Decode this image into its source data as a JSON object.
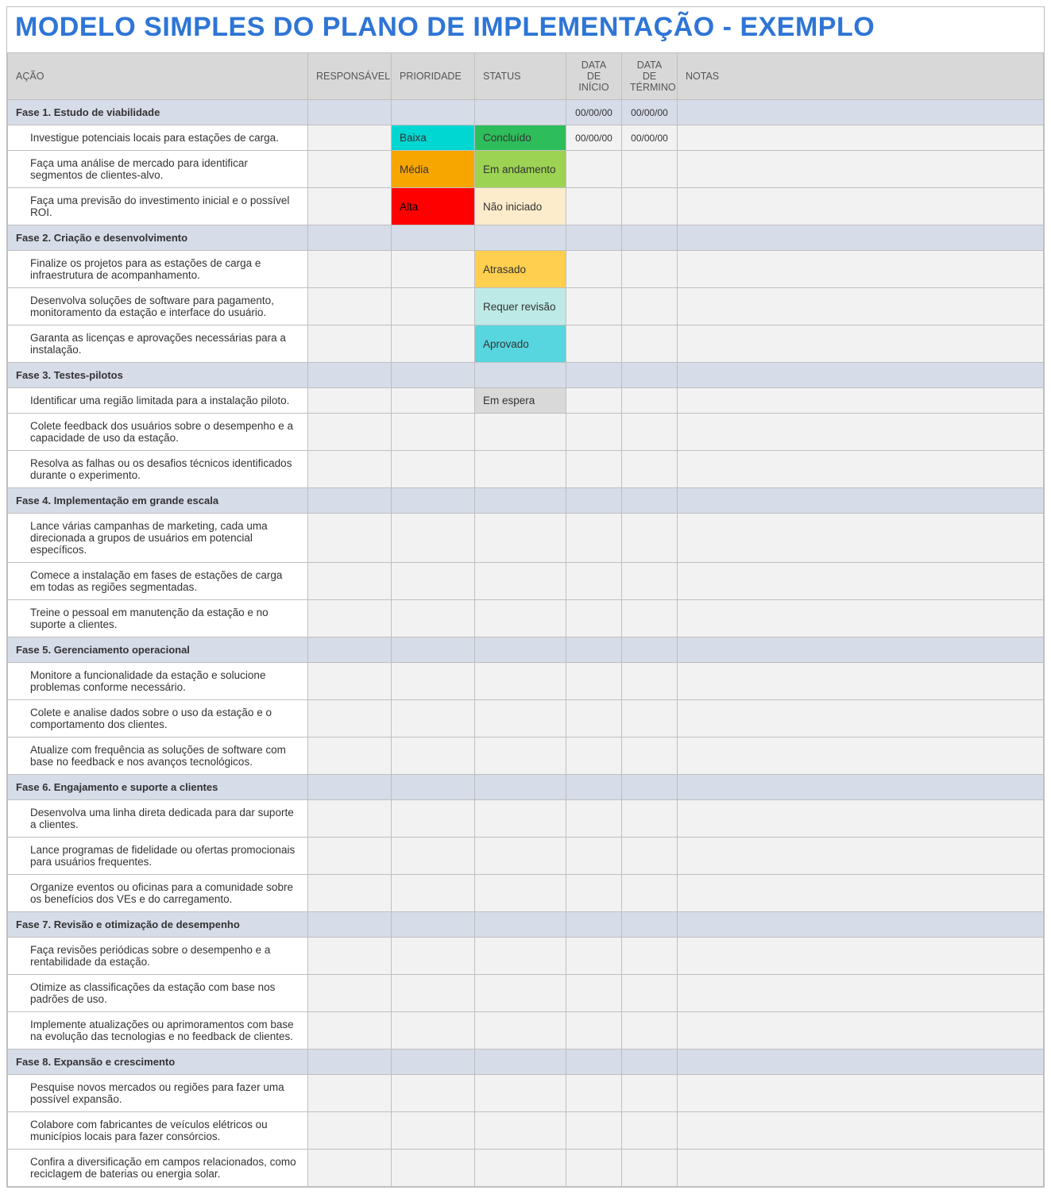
{
  "title": "MODELO SIMPLES DO PLANO DE IMPLEMENTAÇÃO - EXEMPLO",
  "headers": {
    "action": "AÇÃO",
    "responsible": "RESPONSÁVEL",
    "priority": "PRIORIDADE",
    "status": "STATUS",
    "start": "DATA DE INÍCIO",
    "end": "DATA DE TÉRMINO",
    "notes": "NOTAS"
  },
  "date_placeholder": "00/00/00",
  "priority_labels": {
    "baixa": "Baixa",
    "media": "Média",
    "alta": "Alta"
  },
  "status_labels": {
    "concluido": "Concluído",
    "andamento": "Em andamento",
    "nao": "Não iniciado",
    "atrasado": "Atrasado",
    "revisao": "Requer revisão",
    "aprovado": "Aprovado",
    "espera": "Em espera"
  },
  "phases": [
    {
      "label": "Fase 1.  Estudo de viabilidade",
      "start": "00/00/00",
      "end": "00/00/00",
      "tasks": [
        {
          "action": "Investigue potenciais locais para estações de carga.",
          "priority": "baixa",
          "status": "concluido",
          "start": "00/00/00",
          "end": "00/00/00"
        },
        {
          "action": "Faça uma análise de mercado para identificar segmentos de clientes-alvo.",
          "priority": "media",
          "status": "andamento"
        },
        {
          "action": "Faça uma previsão do investimento inicial e o possível ROI.",
          "priority": "alta",
          "status": "nao"
        }
      ]
    },
    {
      "label": "Fase 2.  Criação e desenvolvimento",
      "tasks": [
        {
          "action": "Finalize os projetos para as estações de carga e infraestrutura de acompanhamento.",
          "status": "atrasado"
        },
        {
          "action": "Desenvolva soluções de software para pagamento, monitoramento da estação e interface do usuário.",
          "status": "revisao"
        },
        {
          "action": "Garanta as licenças e aprovações necessárias para a instalação.",
          "status": "aprovado"
        }
      ]
    },
    {
      "label": "Fase 3.  Testes-pilotos",
      "tasks": [
        {
          "action": "Identificar uma região limitada para a instalação piloto.",
          "status": "espera"
        },
        {
          "action": "Colete feedback dos usuários sobre o desempenho e a capacidade de uso da estação."
        },
        {
          "action": "Resolva as falhas ou os desafios técnicos identificados durante o experimento."
        }
      ]
    },
    {
      "label": "Fase 4.  Implementação em grande escala",
      "tasks": [
        {
          "action": "Lance várias campanhas de marketing, cada uma direcionada a grupos de usuários em potencial específicos."
        },
        {
          "action": "Comece a instalação em fases de estações de carga em todas as regiões segmentadas."
        },
        {
          "action": "Treine o pessoal em manutenção da estação e no suporte a clientes."
        }
      ]
    },
    {
      "label": "Fase 5.  Gerenciamento operacional",
      "tasks": [
        {
          "action": "Monitore a funcionalidade da estação e solucione problemas conforme necessário."
        },
        {
          "action": "Colete e analise dados sobre o uso da estação e o comportamento dos clientes."
        },
        {
          "action": "Atualize com frequência as soluções de software com base no feedback e nos avanços tecnológicos."
        }
      ]
    },
    {
      "label": "Fase 6.  Engajamento e suporte a clientes",
      "tasks": [
        {
          "action": "Desenvolva uma linha direta dedicada para dar suporte a clientes."
        },
        {
          "action": "Lance programas de fidelidade ou ofertas promocionais para usuários frequentes."
        },
        {
          "action": "Organize eventos ou oficinas para a comunidade sobre os benefícios dos VEs e do carregamento."
        }
      ]
    },
    {
      "label": "Fase 7.  Revisão e otimização de desempenho",
      "tasks": [
        {
          "action": "Faça revisões periódicas sobre o desempenho e a rentabilidade da estação."
        },
        {
          "action": "Otimize as classificações da estação com base nos padrões de uso."
        },
        {
          "action": "Implemente atualizações ou aprimoramentos com base na evolução das tecnologias e no feedback de clientes."
        }
      ]
    },
    {
      "label": "Fase 8.  Expansão e crescimento",
      "tasks": [
        {
          "action": "Pesquise novos mercados ou regiões para fazer uma possível expansão."
        },
        {
          "action": "Colabore com fabricantes de veículos elétricos ou municípios locais para fazer consórcios."
        },
        {
          "action": "Confira a diversificação em campos relacionados, como reciclagem de baterias ou energia solar."
        }
      ]
    }
  ]
}
